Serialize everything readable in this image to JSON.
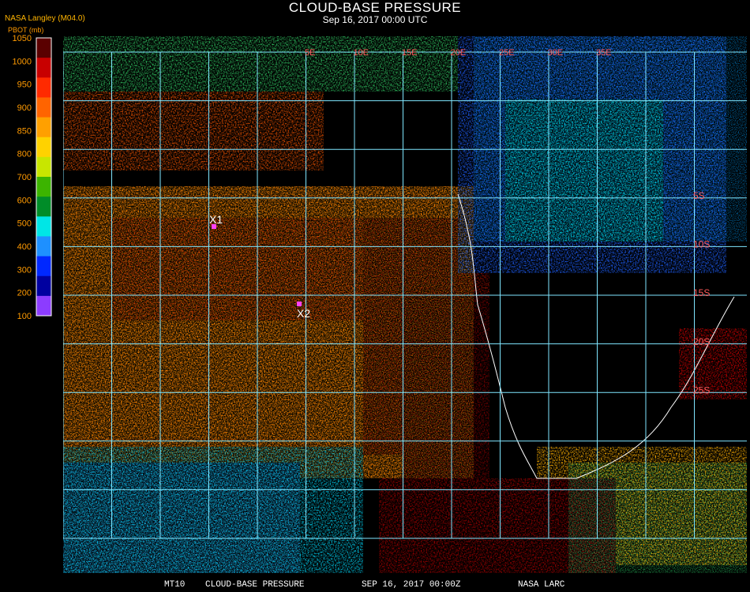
{
  "header": {
    "title": "CLOUD-BASE PRESSURE",
    "datetime": "Sep 16, 2017 00:00 UTC",
    "producer": "NASA Langley (M04.0)",
    "units": "PBOT (mb)"
  },
  "legend": {
    "labels": [
      "1050",
      "1000",
      "950",
      "900",
      "850",
      "800",
      "700",
      "600",
      "500",
      "400",
      "300",
      "200",
      "100"
    ],
    "colors": [
      "#5a0000",
      "#c80000",
      "#ff2a00",
      "#ff6400",
      "#ffa000",
      "#ffd200",
      "#c8e600",
      "#3cb400",
      "#008c28",
      "#00e6e6",
      "#1e90ff",
      "#0028ff",
      "#0000a0",
      "#8c3cff"
    ]
  },
  "map": {
    "grid_color": "#7fe6ff",
    "lat_labels": [
      "5S",
      "10S",
      "15S",
      "20S",
      "25S"
    ],
    "lon_labels": [
      "5E",
      "10E",
      "15E",
      "20E",
      "25E",
      "30E",
      "35E"
    ],
    "markers": [
      {
        "label": "X1",
        "color": "#ff40ff"
      },
      {
        "label": "X2",
        "color": "#ff40ff"
      }
    ]
  },
  "footer": {
    "product": "MT10",
    "name": "CLOUD-BASE PRESSURE",
    "date": "SEP 16, 2017 00:00Z",
    "source": "NASA LARC"
  }
}
